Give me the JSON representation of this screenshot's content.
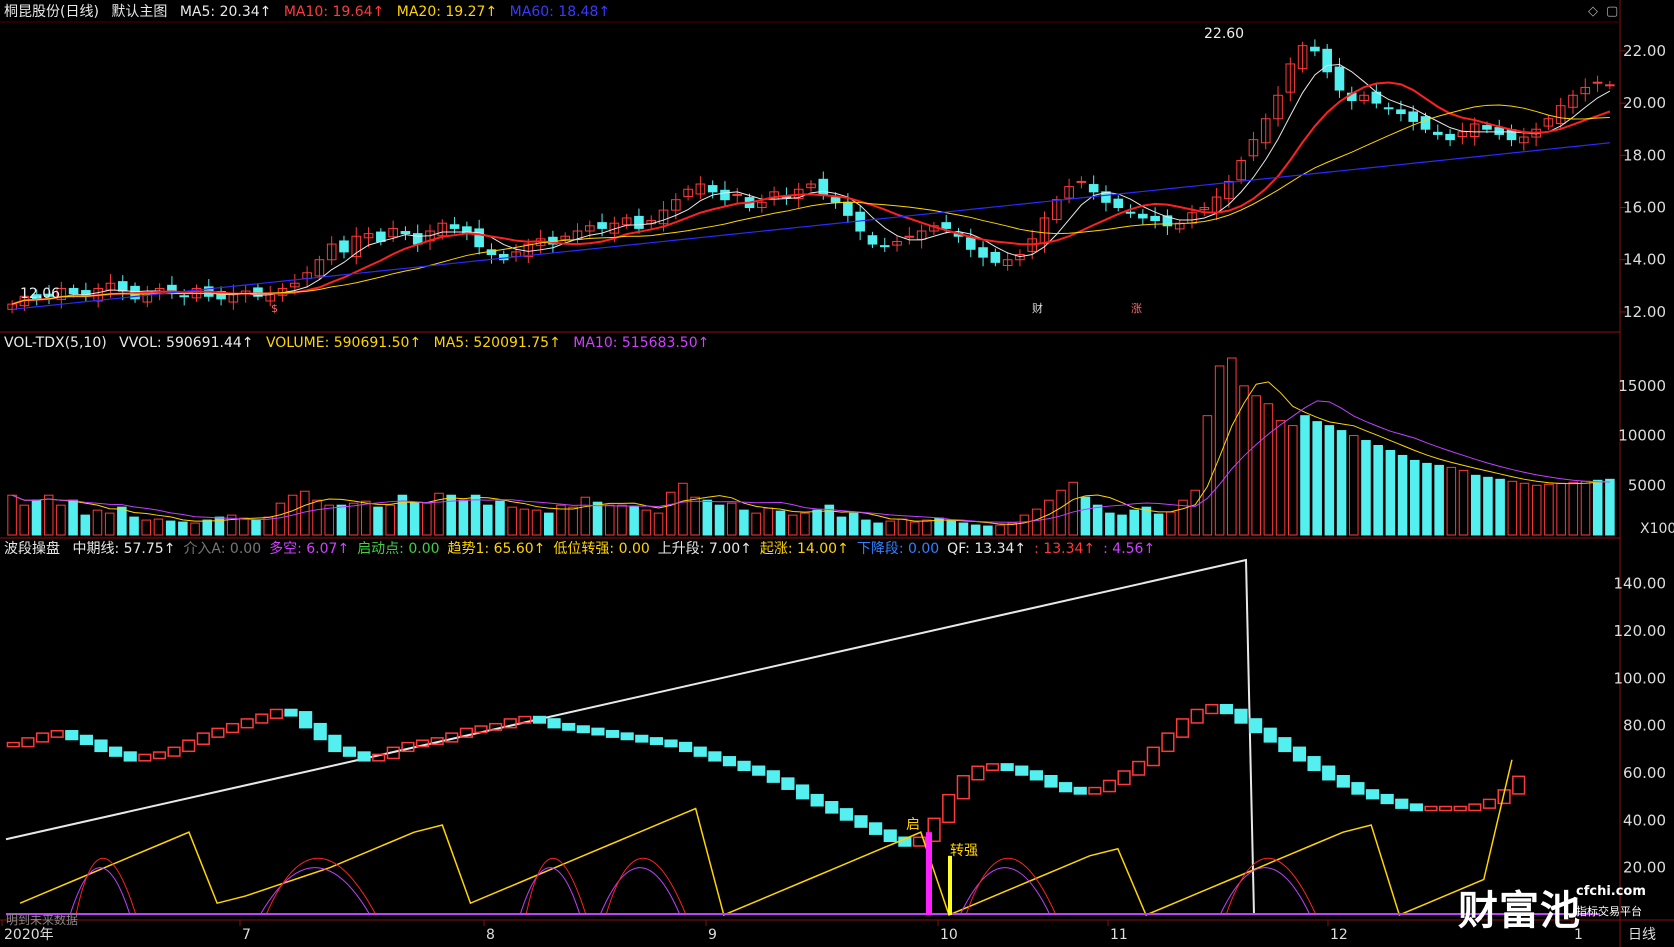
{
  "main_panel": {
    "title": "桐昆股份(日线)",
    "subtitle": "默认主图",
    "ma5": "MA5: 20.34↑",
    "ma10": "MA10: 19.64↑",
    "ma20": "MA20: 19.27↑",
    "ma60": "MA60: 18.48↑",
    "high_label": "22.60",
    "low_label": "12.06",
    "marker_cai": "财",
    "marker_zhang": "涨",
    "marker_s": "$",
    "icons": [
      "diamond-icon",
      "window-icon"
    ]
  },
  "vol_panel": {
    "name": "VOL-TDX(5,10)",
    "vvol": "VVOL: 590691.44↑",
    "volume": "VOLUME: 590691.50↑",
    "ma5": "MA5: 520091.75↑",
    "ma10": "MA10: 515683.50↑",
    "unit": "X100"
  },
  "ind_panel": {
    "name": "波段操盘",
    "items": [
      {
        "text": "中期线: 57.75↑",
        "color": "#e8e8e8"
      },
      {
        "text": "介入A: 0.00",
        "color": "#777777"
      },
      {
        "text": "多空: 6.07↑",
        "color": "#d040ff"
      },
      {
        "text": "启动点: 0.00",
        "color": "#40d040"
      },
      {
        "text": "趋势1: 65.60↑",
        "color": "#ffd400"
      },
      {
        "text": "低位转强: 0.00",
        "color": "#ffd400"
      },
      {
        "text": "上升段: 7.00↑",
        "color": "#e8e8e8"
      },
      {
        "text": "起涨: 14.00↑",
        "color": "#ffd400"
      },
      {
        "text": "下降段: 0.00",
        "color": "#3080ff"
      },
      {
        "text": "QF: 13.34↑",
        "color": "#e8e8e8"
      },
      {
        "text": ": 13.34↑",
        "color": "#ff3a3a"
      },
      {
        "text": ": 4.56↑",
        "color": "#d040ff"
      }
    ],
    "label_qi": "启",
    "label_zhuanqiang": "转强",
    "footer_note": "明到未来数据"
  },
  "x_axis": {
    "labels": [
      "2020年",
      "7",
      "8",
      "9",
      "10",
      "11",
      "12",
      "1"
    ],
    "period": "日线"
  },
  "colors": {
    "up": "#ff3a3a",
    "down": "#54f0f0",
    "ma5": "#e8e8e8",
    "ma10": "#ff2020",
    "ma20": "#ffd400",
    "ma60": "#2a2aff",
    "volma10": "#c040ff"
  },
  "watermark": {
    "brand": "财富池",
    "site": "cfchi.com",
    "tag": "指标交易平台"
  },
  "chart_data": [
    {
      "type": "line",
      "title": "桐昆股份(日线)",
      "ylim": [
        11.5,
        22.8
      ],
      "yticks": [
        12.0,
        14.0,
        16.0,
        18.0,
        20.0,
        22.0
      ],
      "x": [
        "2020-06",
        "2020-07",
        "2020-08",
        "2020-09",
        "2020-10",
        "2020-11",
        "2020-12",
        "2021-01"
      ],
      "close": [
        12.3,
        12.6,
        12.5,
        12.6,
        12.9,
        12.7,
        12.6,
        12.9,
        13.1,
        12.8,
        12.5,
        12.7,
        12.9,
        12.8,
        12.6,
        12.9,
        12.6,
        12.5,
        12.7,
        12.8,
        12.6,
        12.7,
        12.9,
        13.1,
        13.5,
        14.0,
        14.6,
        14.3,
        14.9,
        15.0,
        14.7,
        15.2,
        15.0,
        14.6,
        15.1,
        15.4,
        15.2,
        15.0,
        14.5,
        14.2,
        14.0,
        14.3,
        14.6,
        14.8,
        14.6,
        14.9,
        15.1,
        15.3,
        15.2,
        15.4,
        15.6,
        15.2,
        15.5,
        15.9,
        16.3,
        16.7,
        16.9,
        16.6,
        16.3,
        16.5,
        16.0,
        16.2,
        16.6,
        16.4,
        16.7,
        16.9,
        16.5,
        16.2,
        15.7,
        15.1,
        14.6,
        14.5,
        14.7,
        14.9,
        15.1,
        15.3,
        15.2,
        14.9,
        14.4,
        14.1,
        13.9,
        14.0,
        14.2,
        14.8,
        15.6,
        16.3,
        16.8,
        17.0,
        16.6,
        16.2,
        16.0,
        15.8,
        15.6,
        15.5,
        15.3,
        15.4,
        15.8,
        16.0,
        16.4,
        17.0,
        17.8,
        18.6,
        19.4,
        20.3,
        21.5,
        22.2,
        22.0,
        21.2,
        20.5,
        20.1,
        20.3,
        20.0,
        19.8,
        19.6,
        19.3,
        19.0,
        18.8,
        18.6,
        18.9,
        19.2,
        19.0,
        18.8,
        18.6,
        18.7,
        19.0,
        19.4,
        19.9,
        20.3,
        20.6,
        20.8,
        20.7
      ],
      "series": [
        {
          "name": "MA5",
          "values": [
            20.34
          ]
        },
        {
          "name": "MA10",
          "values": [
            19.64
          ]
        },
        {
          "name": "MA20",
          "values": [
            19.27
          ]
        },
        {
          "name": "MA60",
          "values": [
            18.48
          ]
        }
      ],
      "annotations": [
        {
          "text": "22.60"
        },
        {
          "text": "12.06"
        }
      ]
    },
    {
      "type": "bar",
      "title": "VOL-TDX(5,10)",
      "ylim": [
        0,
        18000
      ],
      "yticks": [
        5000,
        10000,
        15000
      ],
      "unit": "X100",
      "values": [
        4000,
        3000,
        3500,
        4000,
        3000,
        3500,
        2000,
        2500,
        2200,
        2800,
        1800,
        1500,
        1600,
        1400,
        1300,
        1200,
        1500,
        1800,
        2000,
        1700,
        1500,
        1800,
        3200,
        4000,
        4400,
        3500,
        3000,
        3000,
        3200,
        3400,
        2800,
        3000,
        4000,
        3300,
        3200,
        4200,
        4000,
        3500,
        4000,
        3000,
        3400,
        2800,
        2600,
        2500,
        2200,
        3000,
        2800,
        3800,
        3300,
        3000,
        3000,
        2900,
        2500,
        2200,
        4300,
        5200,
        3800,
        3500,
        3000,
        3200,
        2500,
        2200,
        2700,
        2400,
        2000,
        2200,
        2500,
        3000,
        1800,
        2200,
        1500,
        1200,
        1400,
        1600,
        1300,
        1500,
        1700,
        1400,
        1200,
        1000,
        900,
        1000,
        1200,
        2000,
        2600,
        3500,
        4500,
        5300,
        3800,
        3000,
        2200,
        2000,
        2500,
        2800,
        2100,
        2300,
        3500,
        4500,
        12000,
        17000,
        17800,
        15000,
        14000,
        13200,
        11500,
        11000,
        12000,
        11400,
        11000,
        10500,
        10000,
        9500,
        9000,
        8500,
        8000,
        7500,
        7200,
        7000,
        6800,
        6500,
        6000,
        5800,
        5600,
        5400,
        5200,
        5000,
        5100,
        5200,
        5300,
        5400,
        5500,
        5600
      ],
      "series": [
        {
          "name": "VOLUME",
          "values": [
            590691.5
          ]
        },
        {
          "name": "MA5",
          "values": [
            520091.75
          ]
        },
        {
          "name": "MA10",
          "values": [
            515683.5
          ]
        }
      ]
    },
    {
      "type": "line",
      "title": "波段操盘",
      "ylim": [
        0,
        150
      ],
      "yticks": [
        20.0,
        40.0,
        60.0,
        80.0,
        100.0,
        120.0,
        140.0
      ],
      "series": [
        {
          "name": "中期线",
          "values": [
            72,
            74,
            76,
            77,
            75,
            73,
            70,
            68,
            66,
            67,
            68,
            70,
            73,
            76,
            78,
            80,
            82,
            84,
            86,
            85,
            80,
            75,
            70,
            68,
            66,
            67,
            70,
            72,
            73,
            74,
            76,
            78,
            79,
            80,
            82,
            83,
            82,
            80,
            79,
            78,
            77,
            76,
            75,
            74,
            73,
            72,
            70,
            68,
            66,
            64,
            62,
            60,
            57,
            54,
            50,
            47,
            44,
            41,
            38,
            35,
            32,
            30,
            32,
            40,
            50,
            58,
            62,
            63,
            62,
            60,
            58,
            55,
            53,
            52,
            53,
            56,
            60,
            64,
            70,
            76,
            82,
            86,
            88,
            86,
            82,
            78,
            74,
            70,
            66,
            62,
            58,
            55,
            52,
            50,
            48,
            46,
            45,
            45,
            45,
            45,
            46,
            48,
            52,
            57.75
          ]
        },
        {
          "name": "趋势1",
          "values": [
            5,
            10,
            15,
            20,
            25,
            30,
            35,
            5,
            8,
            12,
            16,
            20,
            25,
            30,
            35,
            38,
            5,
            10,
            15,
            20,
            25,
            30,
            35,
            40,
            45,
            0,
            5,
            10,
            15,
            20,
            25,
            30,
            35,
            0,
            5,
            10,
            15,
            20,
            25,
            28,
            0,
            5,
            10,
            15,
            20,
            25,
            30,
            35,
            38,
            0,
            5,
            10,
            15,
            65.6
          ]
        }
      ]
    }
  ]
}
